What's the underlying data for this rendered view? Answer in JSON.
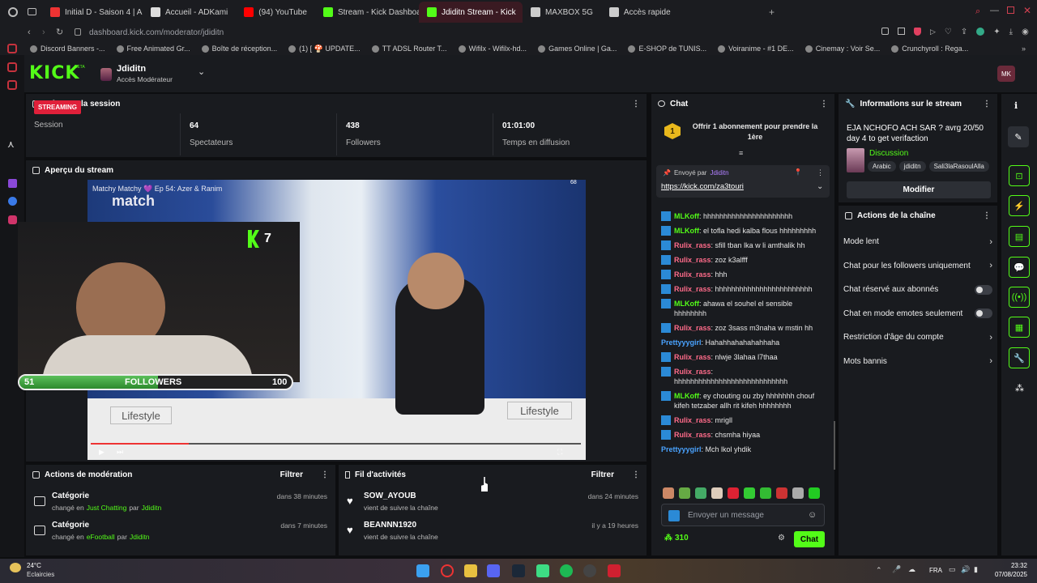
{
  "browser": {
    "tabs": [
      {
        "label": "Initial D - Saison 4 | Anim",
        "color": "#e33"
      },
      {
        "label": "Accueil - ADKami",
        "color": "#ddd"
      },
      {
        "label": "(94) YouTube",
        "color": "#f00"
      },
      {
        "label": "Stream - Kick Dashboard",
        "color": "#53fc18"
      },
      {
        "label": "Jdiditn Stream - Kick",
        "color": "#53fc18",
        "active": true
      },
      {
        "label": "MAXBOX 5G",
        "color": "#ccc"
      },
      {
        "label": "Accès rapide",
        "color": "#ccc"
      }
    ],
    "url": "dashboard.kick.com/moderator/jdiditn",
    "bookmarks": [
      "Discord Banners -...",
      "Free Animated Gr...",
      "Boîte de réception...",
      "(1) [ 🍄 UPDATE...",
      "TT ADSL Router T...",
      "Wifilx - Wifilx-hd...",
      "Games Online | Ga...",
      "E-SHOP de TUNIS...",
      "Voiranime - #1 DE...",
      "Cinemay : Voir Se...",
      "Crunchyroll : Rega..."
    ]
  },
  "header": {
    "logo": "KICK",
    "logo_sup": "BETA",
    "channel_name": "Jdiditn",
    "role": "Accès Modérateur",
    "avatar_initials": "MK"
  },
  "session": {
    "title": "Infos sur la session",
    "streaming_badge": "STREAMING",
    "session_label": "Session",
    "viewers_value": "64",
    "viewers_label": "Spectateurs",
    "followers_value": "438",
    "followers_label": "Followers",
    "duration_value": "01:01:00",
    "duration_label": "Temps en diffusion"
  },
  "preview": {
    "title": "Aperçu du stream",
    "video_title": "Matchy Matchy 💜 Ep 54: Azer & Ranim",
    "brand": "match",
    "kick_counter": "7",
    "followers_goal_label": "FOLLOWERS",
    "followers_current": "51",
    "followers_target": "100",
    "followers_progress": 0.51,
    "viewer_corner": "68",
    "table_sign_left": "Lifestyle",
    "table_sign_right": "Lifestyle"
  },
  "mod_actions": {
    "title": "Actions de modération",
    "filter": "Filtrer",
    "items": [
      {
        "title": "Catégorie",
        "prefix": "changé en",
        "value": "Just Chatting",
        "by": "par",
        "user": "Jdiditn",
        "time": "dans 38 minutes"
      },
      {
        "title": "Catégorie",
        "prefix": "changé en",
        "value": "eFootball",
        "by": "par",
        "user": "Jdiditn",
        "time": "dans 7 minutes"
      }
    ]
  },
  "activity": {
    "title": "Fil d'activités",
    "filter": "Filtrer",
    "items": [
      {
        "user": "SOW_AYOUB",
        "desc": "vient de suivre la chaîne",
        "time": "dans 24 minutes"
      },
      {
        "user": "BEANNN1920",
        "desc": "vient de suivre la chaîne",
        "time": "il y a 19 heures"
      }
    ]
  },
  "chat": {
    "title": "Chat",
    "sub_rank": "1",
    "sub_offer": "Offrir 1 abonnement pour prendre la 1ère",
    "pinned_by": "Envoyé par",
    "pinned_user": "Jdiditn",
    "pinned_link": "https://kick.com/za3touri",
    "messages": [
      {
        "user": "MLKoff",
        "color": "#53fc18",
        "badge": true,
        "text": "hhhhhhhhhhhhhhhhhhhhhh"
      },
      {
        "user": "MLKoff",
        "color": "#53fc18",
        "badge": true,
        "text": "el tofla hedi kalba flous hhhhhhhhh"
      },
      {
        "user": "Rulix_rass",
        "color": "#ff6b8a",
        "badge": true,
        "text": "sfill tban lka w li amthalik hh"
      },
      {
        "user": "Rulix_rass",
        "color": "#ff6b8a",
        "badge": true,
        "text": "zoz k3alfff"
      },
      {
        "user": "Rulix_rass",
        "color": "#ff6b8a",
        "badge": true,
        "text": "hhh"
      },
      {
        "user": "Rulix_rass",
        "color": "#ff6b8a",
        "badge": true,
        "text": "hhhhhhhhhhhhhhhhhhhhhhhh"
      },
      {
        "user": "MLKoff",
        "color": "#53fc18",
        "badge": true,
        "text": "ahawa el souhel el sensible hhhhhhhh"
      },
      {
        "user": "Rulix_rass",
        "color": "#ff6b8a",
        "badge": true,
        "text": "zoz 3sass m3naha w mstin hh"
      },
      {
        "user": "Prettyyygirl",
        "color": "#4aa3ff",
        "badge": false,
        "text": "Hahahhahahahahhaha"
      },
      {
        "user": "Rulix_rass",
        "color": "#ff6b8a",
        "badge": true,
        "text": "nlwje 3lahaa l7thaa"
      },
      {
        "user": "Rulix_rass",
        "color": "#ff6b8a",
        "badge": true,
        "text": "hhhhhhhhhhhhhhhhhhhhhhhhhhhh"
      },
      {
        "user": "MLKoff",
        "color": "#53fc18",
        "badge": true,
        "text": "ey chouting ou zby hhhhhhh chouf kifeh tetzaber allh rit kifeh hhhhhhhh"
      },
      {
        "user": "Rulix_rass",
        "color": "#ff6b8a",
        "badge": true,
        "text": "mrigll"
      },
      {
        "user": "Rulix_rass",
        "color": "#ff6b8a",
        "badge": true,
        "text": "chsmha hiyaa"
      },
      {
        "user": "Prettyyygirl",
        "color": "#4aa3ff",
        "badge": false,
        "text": "Mch lkol yhdik"
      }
    ],
    "input_placeholder": "Envoyer un message",
    "points": "310",
    "send_label": "Chat"
  },
  "stream_info": {
    "title": "Informations sur le stream",
    "stream_title": "EJA NCHOFO ACH SAR ? avrg 20/50 day 4 to get verifaction",
    "category": "Discussion",
    "tags": [
      "Arabic",
      "jdiditn",
      "Sali3laRasoulAlla"
    ],
    "edit_button": "Modifier"
  },
  "channel_actions": {
    "title": "Actions de la chaîne",
    "rows": [
      {
        "label": "Mode lent",
        "kind": "arrow"
      },
      {
        "label": "Chat pour les followers uniquement",
        "kind": "arrow"
      },
      {
        "label": "Chat réservé aux abonnés",
        "kind": "toggle"
      },
      {
        "label": "Chat en mode emotes seulement",
        "kind": "toggle"
      },
      {
        "label": "Restriction d'âge du compte",
        "kind": "arrow"
      },
      {
        "label": "Mots bannis",
        "kind": "arrow"
      }
    ]
  },
  "taskbar": {
    "weather_temp": "24°C",
    "weather_desc": "Eclaircies",
    "lang": "FRA",
    "time": "23:32",
    "date": "07/08/2025"
  }
}
